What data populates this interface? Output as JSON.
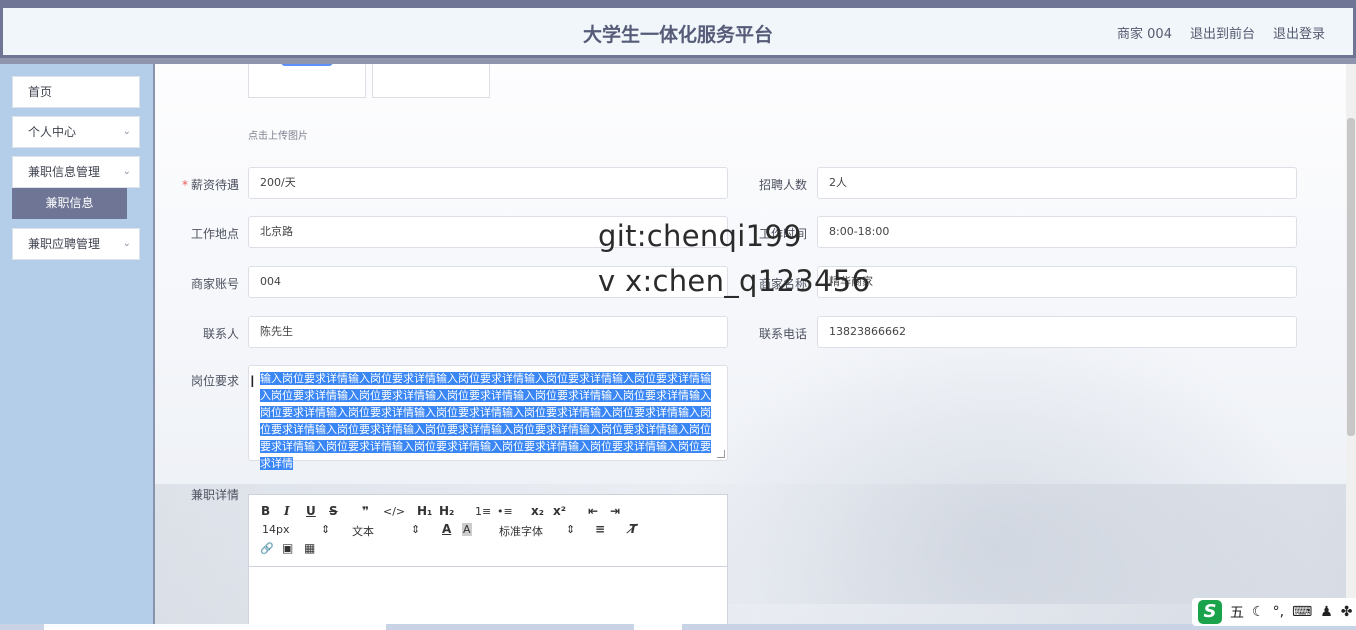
{
  "header": {
    "title": "大学生一体化服务平台",
    "links": [
      "商家 004",
      "退出到前台",
      "退出登录"
    ]
  },
  "sidebar": {
    "items": [
      {
        "label": "首页",
        "has_chevron": false
      },
      {
        "label": "个人中心",
        "has_chevron": true
      },
      {
        "label": "兼职信息管理",
        "has_chevron": true
      },
      {
        "label": "兼职应聘管理",
        "has_chevron": true
      }
    ],
    "active_sub": "兼职信息"
  },
  "form": {
    "upload_hint": "点击上传图片",
    "salary": {
      "label": "薪资待遇",
      "value": "200/天",
      "required": true
    },
    "headcount": {
      "label": "招聘人数",
      "value": "2人"
    },
    "location": {
      "label": "工作地点",
      "value": "北京路"
    },
    "work_time": {
      "label": "工作时间",
      "value": "8:00-18:00"
    },
    "merchant_account": {
      "label": "商家账号",
      "value": "004"
    },
    "merchant_name": {
      "label": "商家名称",
      "value": "精华商家"
    },
    "contact": {
      "label": "联系人",
      "value": "陈先生"
    },
    "phone": {
      "label": "联系电话",
      "value": "13823866662"
    },
    "requirements": {
      "label": "岗位要求",
      "value": "输入岗位要求详情输入岗位要求详情输入岗位要求详情输入岗位要求详情输入岗位要求详情输入岗位要求详情输入岗位要求详情输入岗位要求详情输入岗位要求详情输入岗位要求详情输入岗位要求详情输入岗位要求详情输入岗位要求详情输入岗位要求详情输入岗位要求详情输入岗位要求详情输入岗位要求详情输入岗位要求详情输入岗位要求详情输入岗位要求详情输入岗位要求详情输入岗位要求详情输入岗位要求详情输入岗位要求详情输入岗位要求详情输入岗位要求详情"
    },
    "details": {
      "label": "兼职详情"
    }
  },
  "editor": {
    "font_size": "14px",
    "block_type": "文本",
    "font_family": "标准字体",
    "buttons": {
      "bold": "B",
      "italic": "I",
      "underline": "U",
      "strike": "S",
      "quote": "❞",
      "code": "</>",
      "h1": "H₁",
      "h2": "H₂",
      "ol": "1≡",
      "ul": "•≡",
      "sub": "x₂",
      "sup": "x²",
      "outdent": "⇤",
      "indent": "⇥",
      "color": "A",
      "bg": "A",
      "align": "≡",
      "clear": "T̸",
      "link": "🔗",
      "image": "▣",
      "video": "▦"
    }
  },
  "watermark": {
    "line1": "git:chenqi199",
    "line2": "v x:chen_q123456"
  },
  "ime": {
    "mode": "五"
  },
  "colors": {
    "theme": "#6f7594",
    "sidebar_bg": "#b4cee9",
    "selection": "#3a86f5"
  }
}
